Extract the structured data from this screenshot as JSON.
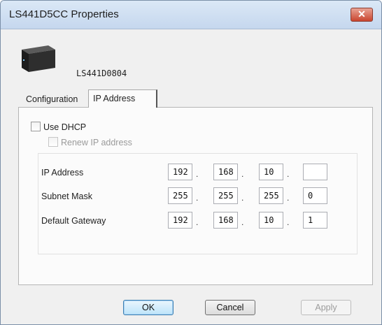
{
  "window": {
    "title": "LS441D5CC Properties",
    "close_label": "✕"
  },
  "device": {
    "name": "LS441D0804"
  },
  "tabs": [
    {
      "label": "Configuration"
    },
    {
      "label": "IP Address"
    }
  ],
  "dhcp": {
    "use_dhcp_label": "Use DHCP",
    "renew_label": "Renew IP address"
  },
  "ip_settings": {
    "ip_address": {
      "label": "IP Address",
      "octets": [
        "192",
        "168",
        "10",
        ""
      ]
    },
    "subnet_mask": {
      "label": "Subnet Mask",
      "octets": [
        "255",
        "255",
        "255",
        "0"
      ]
    },
    "default_gateway": {
      "label": "Default Gateway",
      "octets": [
        "192",
        "168",
        "10",
        "1"
      ]
    }
  },
  "buttons": {
    "ok": "OK",
    "cancel": "Cancel",
    "apply": "Apply"
  }
}
